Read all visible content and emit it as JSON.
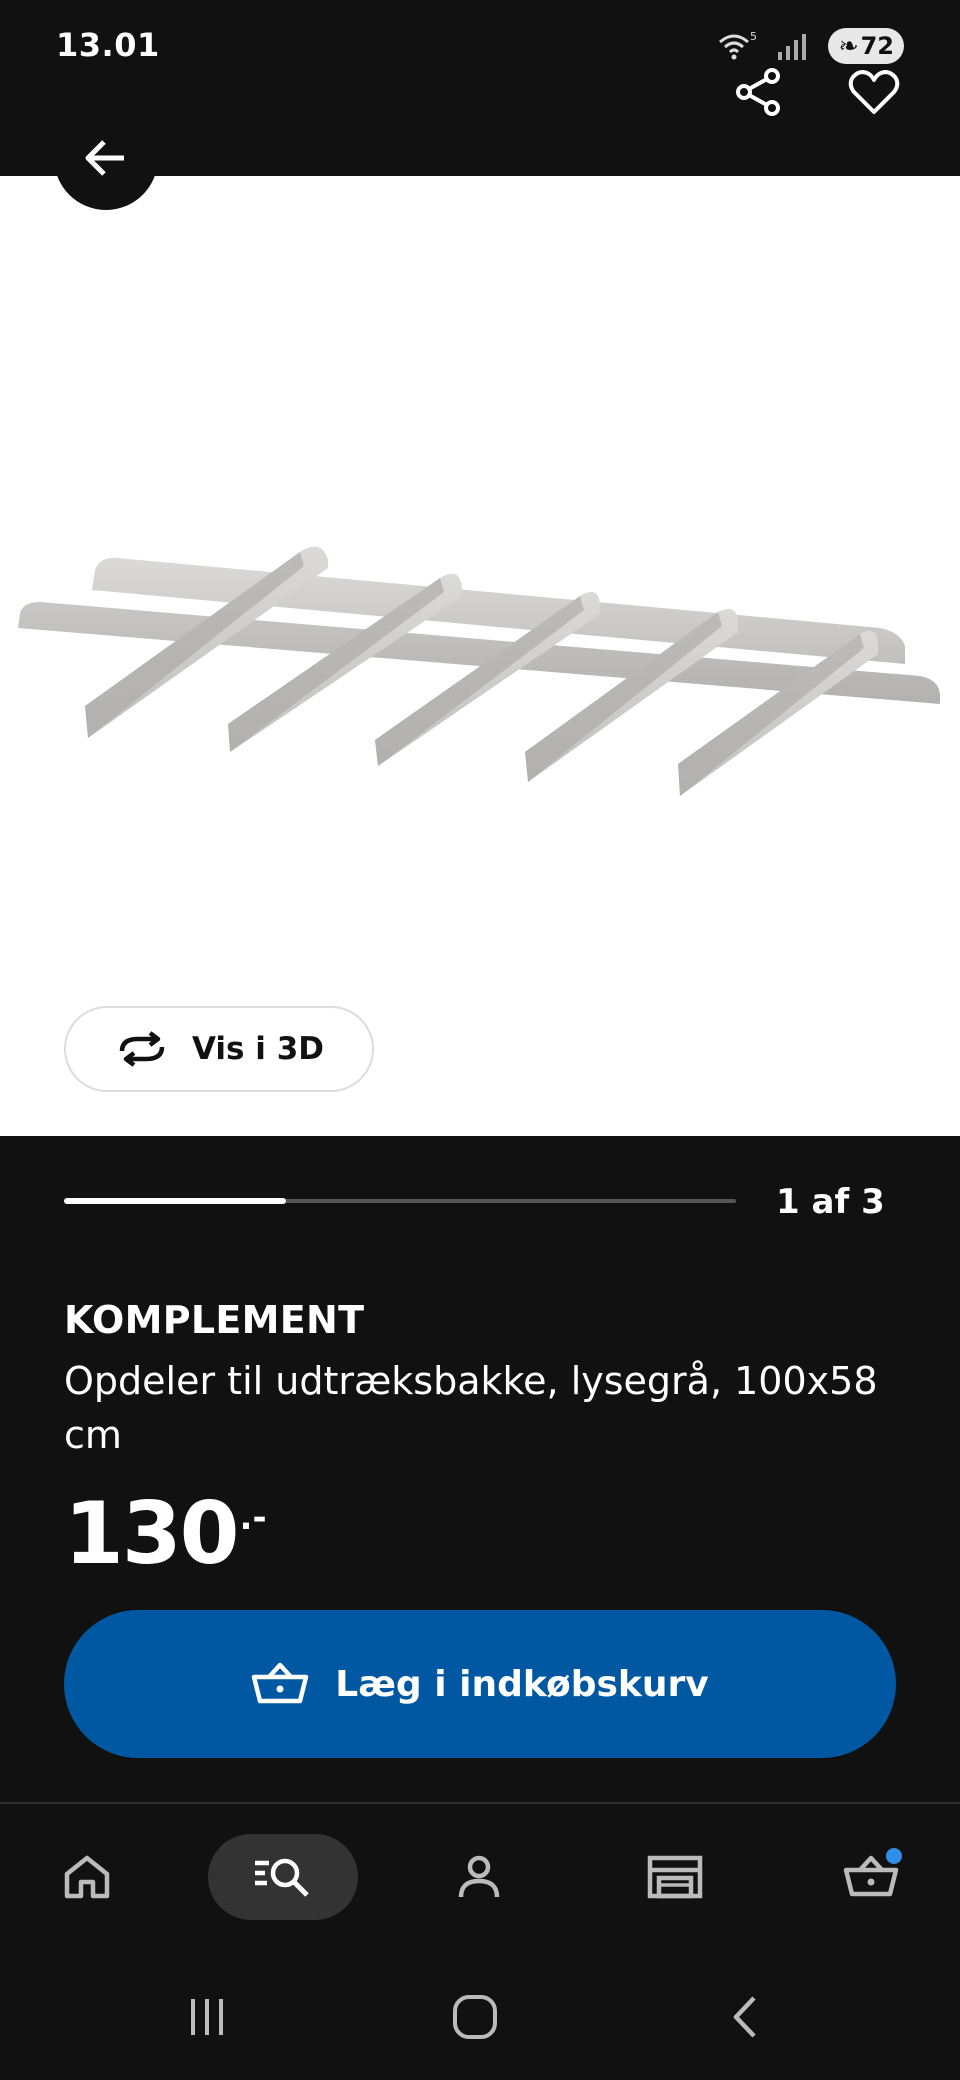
{
  "status_bar": {
    "time": "13.01",
    "battery": "72",
    "wifi_label": "5"
  },
  "header": {
    "back_icon": "arrow-left-icon",
    "share_icon": "share-icon",
    "favorite_icon": "heart-icon"
  },
  "gallery": {
    "view_3d_label": "Vis i 3D",
    "page_indicator": "1 af 3",
    "progress": 0.33
  },
  "product": {
    "name": "KOMPLEMENT",
    "description": "Opdeler til udtræksbakke, lysegrå, 100x58 cm",
    "price": "130",
    "price_suffix": ".-"
  },
  "cart_button": {
    "label": "Læg i indkøbskurv",
    "icon": "basket-icon"
  },
  "bottom_nav": {
    "items": [
      {
        "icon": "home-icon"
      },
      {
        "icon": "search-icon",
        "active": true
      },
      {
        "icon": "profile-icon"
      },
      {
        "icon": "store-icon"
      },
      {
        "icon": "cart-icon",
        "badge": true
      }
    ]
  },
  "colors": {
    "background": "#111111",
    "primary_button": "#0058a3",
    "badge": "#2f8fe8"
  }
}
